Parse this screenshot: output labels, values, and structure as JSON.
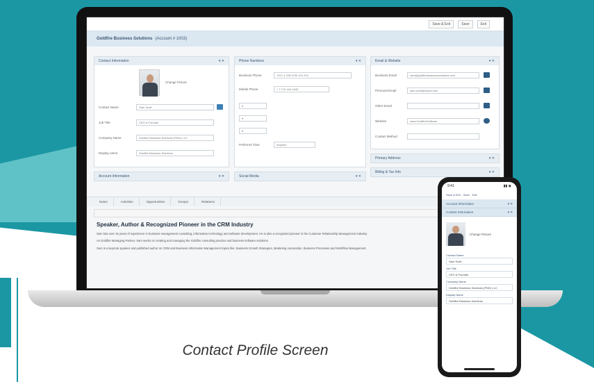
{
  "window": {
    "title": "Goldfire Business Solutions",
    "account": "(Account # 1003)"
  },
  "toolbar": {
    "save_close": "Save & Exit",
    "save": "Save",
    "exit": "Exit"
  },
  "panels": {
    "contact_info": {
      "title": "Contact Information",
      "change_picture": "Change Picture",
      "contact_name_label": "Contact Name",
      "contact_name": "Sam Scott",
      "job_title_label": "Job Title",
      "job_title": "CEO & Founder",
      "company_label": "Company Name",
      "company": "Goldfire Business Solutions (PNG) LLC",
      "display_label": "Display name",
      "display": "Goldfire Business Solutions"
    },
    "phone_numbers": {
      "title": "Phone Numbers",
      "business_label": "Business Phone",
      "business": "+971 4 228 0700 101 215",
      "mobile_label": "Mobile Phone",
      "mobile": "+ 7 714 444 4443",
      "preferred_label": "Preferred Time",
      "preferred": "Anytime"
    },
    "email_web": {
      "title": "Email & Website",
      "business_email_label": "Business Email",
      "business_email": "sam@goldfirebusinesssolutions.com",
      "personal_email_label": "Personal Email",
      "personal_email": "sam.scott@icloud.com",
      "other_email_label": "Other Email",
      "website_label": "Website",
      "website": "www.GoldfireSoftware",
      "contact_method_label": "Contact Method"
    },
    "address": {
      "title": "Primary Address"
    },
    "billing": {
      "title": "Billing & Tax Info"
    },
    "account_info": {
      "title": "Account Information"
    },
    "social": {
      "title": "Social Media"
    }
  },
  "tabs": [
    "Notes",
    "Activities",
    "Opportunities",
    "Groups",
    "Relations"
  ],
  "editor": {
    "heading": "Speaker, Author & Recognized Pioneer in the CRM Industry",
    "paragraphs": [
      "Sam has over 15 years of experience in business management consulting, information technology and software development. He is also a recognized pioneer in the Customer Relationship Management industry.",
      "As Goldfire Managing Partner, Sam works on creating and managing the Goldfire consulting practice and business software solutions.",
      "Sam is a keynote speaker and published author on CRM and Business Information Management topics like: Business Growth Strategies, Marketing Automation, Business Processes and Workflow Management."
    ]
  },
  "phone_app": {
    "time": "9:41",
    "buttons": [
      "Save & Exit",
      "Save",
      "Exit"
    ],
    "sections": [
      "Account Information",
      "Contact Information"
    ],
    "change_picture": "Change Picture",
    "fields": [
      {
        "label": "Contact Name",
        "value": "Sam Scott"
      },
      {
        "label": "Job Title",
        "value": "CEO & Founder"
      },
      {
        "label": "Company Name",
        "value": "Goldfire Business Solutions (PNG) LLC"
      },
      {
        "label": "Display Name",
        "value": "Goldfire Business Solutions"
      }
    ]
  },
  "caption": "Contact Profile Screen"
}
